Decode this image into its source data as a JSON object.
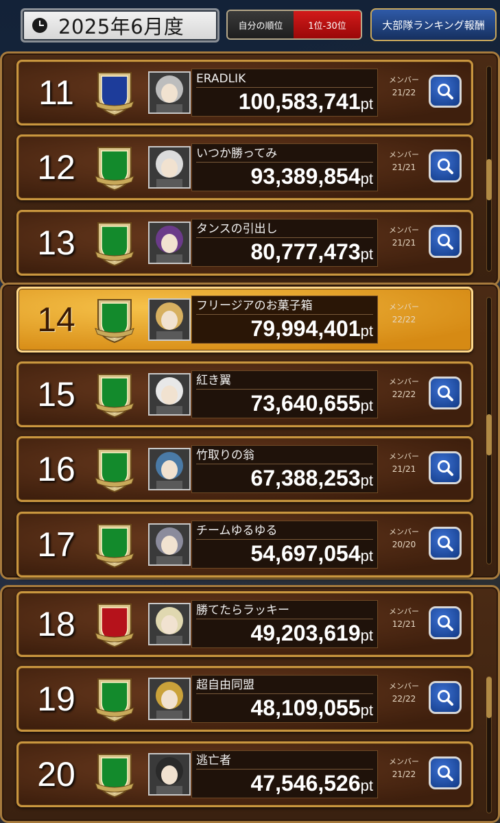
{
  "header": {
    "period": "2025年6月度",
    "my_rank_label": "自分の順位",
    "my_rank_value": "1位-30位",
    "reward_button": "大部隊ランキング報酬"
  },
  "colors": {
    "rank_a": "#1d3c9a",
    "rank_b": "#138a2c",
    "rank_c": "#b5121b",
    "highlight": "#f0b13a"
  },
  "member_label": "メンバー",
  "pt_unit": "pt",
  "teams": [
    {
      "rank": "11",
      "grade": "A",
      "name": "ERADLIK",
      "score": "100,583,741",
      "members": "21/22",
      "highlight": false
    },
    {
      "rank": "12",
      "grade": "B",
      "name": "いつか勝ってみ",
      "score": "93,389,854",
      "members": "21/21",
      "highlight": false
    },
    {
      "rank": "13",
      "grade": "B",
      "name": "タンスの引出し",
      "score": "80,777,473",
      "members": "21/21",
      "highlight": false
    },
    {
      "rank": "14",
      "grade": "B",
      "name": "フリージアのお菓子箱",
      "score": "79,994,401",
      "members": "22/22",
      "highlight": true
    },
    {
      "rank": "15",
      "grade": "B",
      "name": "紅き翼",
      "score": "73,640,655",
      "members": "22/22",
      "highlight": false
    },
    {
      "rank": "16",
      "grade": "B",
      "name": "竹取りの翁",
      "score": "67,388,253",
      "members": "21/21",
      "highlight": false
    },
    {
      "rank": "17",
      "grade": "B",
      "name": "チームゆるゆる",
      "score": "54,697,054",
      "members": "20/20",
      "highlight": false
    },
    {
      "rank": "18",
      "grade": "C",
      "name": "勝てたらラッキー",
      "score": "49,203,619",
      "members": "12/21",
      "highlight": false
    },
    {
      "rank": "19",
      "grade": "B",
      "name": "超自由同盟",
      "score": "48,109,055",
      "members": "22/22",
      "highlight": false
    },
    {
      "rank": "20",
      "grade": "B",
      "name": "逃亡者",
      "score": "47,546,526",
      "members": "21/22",
      "highlight": false
    }
  ]
}
